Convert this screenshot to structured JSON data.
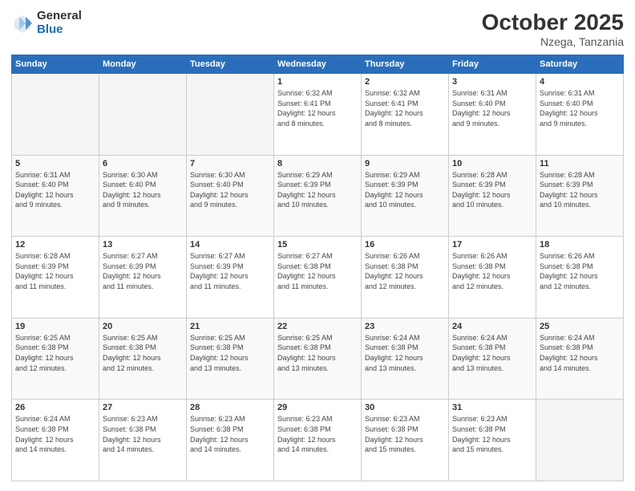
{
  "logo": {
    "general": "General",
    "blue": "Blue"
  },
  "title": "October 2025",
  "location": "Nzega, Tanzania",
  "days_of_week": [
    "Sunday",
    "Monday",
    "Tuesday",
    "Wednesday",
    "Thursday",
    "Friday",
    "Saturday"
  ],
  "weeks": [
    [
      {
        "day": "",
        "info": ""
      },
      {
        "day": "",
        "info": ""
      },
      {
        "day": "",
        "info": ""
      },
      {
        "day": "1",
        "info": "Sunrise: 6:32 AM\nSunset: 6:41 PM\nDaylight: 12 hours\nand 8 minutes."
      },
      {
        "day": "2",
        "info": "Sunrise: 6:32 AM\nSunset: 6:41 PM\nDaylight: 12 hours\nand 8 minutes."
      },
      {
        "day": "3",
        "info": "Sunrise: 6:31 AM\nSunset: 6:40 PM\nDaylight: 12 hours\nand 9 minutes."
      },
      {
        "day": "4",
        "info": "Sunrise: 6:31 AM\nSunset: 6:40 PM\nDaylight: 12 hours\nand 9 minutes."
      }
    ],
    [
      {
        "day": "5",
        "info": "Sunrise: 6:31 AM\nSunset: 6:40 PM\nDaylight: 12 hours\nand 9 minutes."
      },
      {
        "day": "6",
        "info": "Sunrise: 6:30 AM\nSunset: 6:40 PM\nDaylight: 12 hours\nand 9 minutes."
      },
      {
        "day": "7",
        "info": "Sunrise: 6:30 AM\nSunset: 6:40 PM\nDaylight: 12 hours\nand 9 minutes."
      },
      {
        "day": "8",
        "info": "Sunrise: 6:29 AM\nSunset: 6:39 PM\nDaylight: 12 hours\nand 10 minutes."
      },
      {
        "day": "9",
        "info": "Sunrise: 6:29 AM\nSunset: 6:39 PM\nDaylight: 12 hours\nand 10 minutes."
      },
      {
        "day": "10",
        "info": "Sunrise: 6:28 AM\nSunset: 6:39 PM\nDaylight: 12 hours\nand 10 minutes."
      },
      {
        "day": "11",
        "info": "Sunrise: 6:28 AM\nSunset: 6:39 PM\nDaylight: 12 hours\nand 10 minutes."
      }
    ],
    [
      {
        "day": "12",
        "info": "Sunrise: 6:28 AM\nSunset: 6:39 PM\nDaylight: 12 hours\nand 11 minutes."
      },
      {
        "day": "13",
        "info": "Sunrise: 6:27 AM\nSunset: 6:39 PM\nDaylight: 12 hours\nand 11 minutes."
      },
      {
        "day": "14",
        "info": "Sunrise: 6:27 AM\nSunset: 6:39 PM\nDaylight: 12 hours\nand 11 minutes."
      },
      {
        "day": "15",
        "info": "Sunrise: 6:27 AM\nSunset: 6:38 PM\nDaylight: 12 hours\nand 11 minutes."
      },
      {
        "day": "16",
        "info": "Sunrise: 6:26 AM\nSunset: 6:38 PM\nDaylight: 12 hours\nand 12 minutes."
      },
      {
        "day": "17",
        "info": "Sunrise: 6:26 AM\nSunset: 6:38 PM\nDaylight: 12 hours\nand 12 minutes."
      },
      {
        "day": "18",
        "info": "Sunrise: 6:26 AM\nSunset: 6:38 PM\nDaylight: 12 hours\nand 12 minutes."
      }
    ],
    [
      {
        "day": "19",
        "info": "Sunrise: 6:25 AM\nSunset: 6:38 PM\nDaylight: 12 hours\nand 12 minutes."
      },
      {
        "day": "20",
        "info": "Sunrise: 6:25 AM\nSunset: 6:38 PM\nDaylight: 12 hours\nand 12 minutes."
      },
      {
        "day": "21",
        "info": "Sunrise: 6:25 AM\nSunset: 6:38 PM\nDaylight: 12 hours\nand 13 minutes."
      },
      {
        "day": "22",
        "info": "Sunrise: 6:25 AM\nSunset: 6:38 PM\nDaylight: 12 hours\nand 13 minutes."
      },
      {
        "day": "23",
        "info": "Sunrise: 6:24 AM\nSunset: 6:38 PM\nDaylight: 12 hours\nand 13 minutes."
      },
      {
        "day": "24",
        "info": "Sunrise: 6:24 AM\nSunset: 6:38 PM\nDaylight: 12 hours\nand 13 minutes."
      },
      {
        "day": "25",
        "info": "Sunrise: 6:24 AM\nSunset: 6:38 PM\nDaylight: 12 hours\nand 14 minutes."
      }
    ],
    [
      {
        "day": "26",
        "info": "Sunrise: 6:24 AM\nSunset: 6:38 PM\nDaylight: 12 hours\nand 14 minutes."
      },
      {
        "day": "27",
        "info": "Sunrise: 6:23 AM\nSunset: 6:38 PM\nDaylight: 12 hours\nand 14 minutes."
      },
      {
        "day": "28",
        "info": "Sunrise: 6:23 AM\nSunset: 6:38 PM\nDaylight: 12 hours\nand 14 minutes."
      },
      {
        "day": "29",
        "info": "Sunrise: 6:23 AM\nSunset: 6:38 PM\nDaylight: 12 hours\nand 14 minutes."
      },
      {
        "day": "30",
        "info": "Sunrise: 6:23 AM\nSunset: 6:38 PM\nDaylight: 12 hours\nand 15 minutes."
      },
      {
        "day": "31",
        "info": "Sunrise: 6:23 AM\nSunset: 6:38 PM\nDaylight: 12 hours\nand 15 minutes."
      },
      {
        "day": "",
        "info": ""
      }
    ]
  ]
}
